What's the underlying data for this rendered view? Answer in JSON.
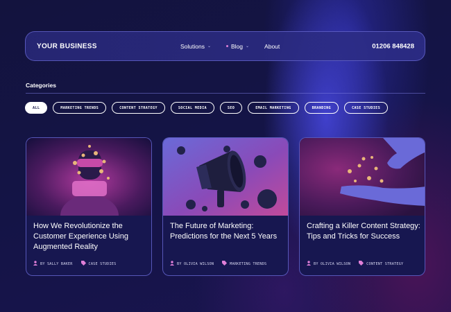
{
  "header": {
    "logo": "YOUR BUSINESS",
    "nav": [
      {
        "label": "Solutions"
      },
      {
        "label": "Blog"
      },
      {
        "label": "About"
      }
    ],
    "phone": "01206 848428"
  },
  "categories": {
    "title": "Categories",
    "chips": [
      "ALL",
      "MARKETING TRENDS",
      "CONTENT STRATEGY",
      "SOCIAL MEDIA",
      "SEO",
      "EMAIL MARKETING",
      "BRANDING",
      "CASE STUDIES"
    ],
    "active_index": 0
  },
  "posts": [
    {
      "title": "How We Revolutionize the Customer Experience Using Augmented Reality",
      "author": "BY SALLY BAKER",
      "category": "CASE STUDIES"
    },
    {
      "title": "The Future of Marketing: Predictions for the Next 5 Years",
      "author": "BY OLIVIA WILSON",
      "category": "MARKETING TRENDS"
    },
    {
      "title": "Crafting a Killer Content Strategy: Tips and Tricks for Success",
      "author": "BY OLIVIA WILSON",
      "category": "CONTENT STRATEGY"
    }
  ],
  "colors": {
    "background": "#12123d",
    "accent_pink": "#e07fd8",
    "card_border": "#6e6edc"
  }
}
